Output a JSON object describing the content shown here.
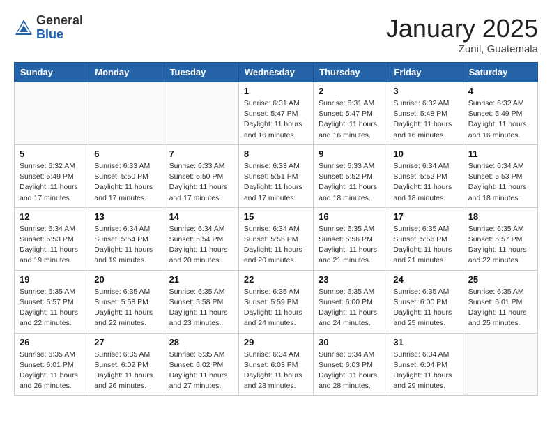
{
  "header": {
    "logo_general": "General",
    "logo_blue": "Blue",
    "month_title": "January 2025",
    "location": "Zunil, Guatemala"
  },
  "days_of_week": [
    "Sunday",
    "Monday",
    "Tuesday",
    "Wednesday",
    "Thursday",
    "Friday",
    "Saturday"
  ],
  "weeks": [
    [
      {
        "day": "",
        "info": ""
      },
      {
        "day": "",
        "info": ""
      },
      {
        "day": "",
        "info": ""
      },
      {
        "day": "1",
        "info": "Sunrise: 6:31 AM\nSunset: 5:47 PM\nDaylight: 11 hours\nand 16 minutes."
      },
      {
        "day": "2",
        "info": "Sunrise: 6:31 AM\nSunset: 5:47 PM\nDaylight: 11 hours\nand 16 minutes."
      },
      {
        "day": "3",
        "info": "Sunrise: 6:32 AM\nSunset: 5:48 PM\nDaylight: 11 hours\nand 16 minutes."
      },
      {
        "day": "4",
        "info": "Sunrise: 6:32 AM\nSunset: 5:49 PM\nDaylight: 11 hours\nand 16 minutes."
      }
    ],
    [
      {
        "day": "5",
        "info": "Sunrise: 6:32 AM\nSunset: 5:49 PM\nDaylight: 11 hours\nand 17 minutes."
      },
      {
        "day": "6",
        "info": "Sunrise: 6:33 AM\nSunset: 5:50 PM\nDaylight: 11 hours\nand 17 minutes."
      },
      {
        "day": "7",
        "info": "Sunrise: 6:33 AM\nSunset: 5:50 PM\nDaylight: 11 hours\nand 17 minutes."
      },
      {
        "day": "8",
        "info": "Sunrise: 6:33 AM\nSunset: 5:51 PM\nDaylight: 11 hours\nand 17 minutes."
      },
      {
        "day": "9",
        "info": "Sunrise: 6:33 AM\nSunset: 5:52 PM\nDaylight: 11 hours\nand 18 minutes."
      },
      {
        "day": "10",
        "info": "Sunrise: 6:34 AM\nSunset: 5:52 PM\nDaylight: 11 hours\nand 18 minutes."
      },
      {
        "day": "11",
        "info": "Sunrise: 6:34 AM\nSunset: 5:53 PM\nDaylight: 11 hours\nand 18 minutes."
      }
    ],
    [
      {
        "day": "12",
        "info": "Sunrise: 6:34 AM\nSunset: 5:53 PM\nDaylight: 11 hours\nand 19 minutes."
      },
      {
        "day": "13",
        "info": "Sunrise: 6:34 AM\nSunset: 5:54 PM\nDaylight: 11 hours\nand 19 minutes."
      },
      {
        "day": "14",
        "info": "Sunrise: 6:34 AM\nSunset: 5:54 PM\nDaylight: 11 hours\nand 20 minutes."
      },
      {
        "day": "15",
        "info": "Sunrise: 6:34 AM\nSunset: 5:55 PM\nDaylight: 11 hours\nand 20 minutes."
      },
      {
        "day": "16",
        "info": "Sunrise: 6:35 AM\nSunset: 5:56 PM\nDaylight: 11 hours\nand 21 minutes."
      },
      {
        "day": "17",
        "info": "Sunrise: 6:35 AM\nSunset: 5:56 PM\nDaylight: 11 hours\nand 21 minutes."
      },
      {
        "day": "18",
        "info": "Sunrise: 6:35 AM\nSunset: 5:57 PM\nDaylight: 11 hours\nand 22 minutes."
      }
    ],
    [
      {
        "day": "19",
        "info": "Sunrise: 6:35 AM\nSunset: 5:57 PM\nDaylight: 11 hours\nand 22 minutes."
      },
      {
        "day": "20",
        "info": "Sunrise: 6:35 AM\nSunset: 5:58 PM\nDaylight: 11 hours\nand 22 minutes."
      },
      {
        "day": "21",
        "info": "Sunrise: 6:35 AM\nSunset: 5:58 PM\nDaylight: 11 hours\nand 23 minutes."
      },
      {
        "day": "22",
        "info": "Sunrise: 6:35 AM\nSunset: 5:59 PM\nDaylight: 11 hours\nand 24 minutes."
      },
      {
        "day": "23",
        "info": "Sunrise: 6:35 AM\nSunset: 6:00 PM\nDaylight: 11 hours\nand 24 minutes."
      },
      {
        "day": "24",
        "info": "Sunrise: 6:35 AM\nSunset: 6:00 PM\nDaylight: 11 hours\nand 25 minutes."
      },
      {
        "day": "25",
        "info": "Sunrise: 6:35 AM\nSunset: 6:01 PM\nDaylight: 11 hours\nand 25 minutes."
      }
    ],
    [
      {
        "day": "26",
        "info": "Sunrise: 6:35 AM\nSunset: 6:01 PM\nDaylight: 11 hours\nand 26 minutes."
      },
      {
        "day": "27",
        "info": "Sunrise: 6:35 AM\nSunset: 6:02 PM\nDaylight: 11 hours\nand 26 minutes."
      },
      {
        "day": "28",
        "info": "Sunrise: 6:35 AM\nSunset: 6:02 PM\nDaylight: 11 hours\nand 27 minutes."
      },
      {
        "day": "29",
        "info": "Sunrise: 6:34 AM\nSunset: 6:03 PM\nDaylight: 11 hours\nand 28 minutes."
      },
      {
        "day": "30",
        "info": "Sunrise: 6:34 AM\nSunset: 6:03 PM\nDaylight: 11 hours\nand 28 minutes."
      },
      {
        "day": "31",
        "info": "Sunrise: 6:34 AM\nSunset: 6:04 PM\nDaylight: 11 hours\nand 29 minutes."
      },
      {
        "day": "",
        "info": ""
      }
    ]
  ]
}
